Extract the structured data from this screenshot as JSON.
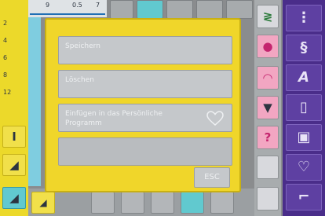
{
  "menu": {
    "items": [
      {
        "label": "Speichern",
        "enabled": true
      },
      {
        "label": "Löschen",
        "enabled": true
      },
      {
        "label": "Einfügen in das Persönliche Programm",
        "enabled": true,
        "icon": "heart-icon"
      },
      {
        "label": "",
        "enabled": false
      }
    ],
    "esc_label": "ESC"
  },
  "top_ruler": {
    "labels": [
      "9",
      "0.5",
      "7"
    ]
  },
  "left_ruler": {
    "labels": [
      "2",
      "4",
      "6",
      "8",
      "12"
    ]
  },
  "colors": {
    "dialog": "#f0d62a",
    "accent_purple": "#4a2d8a",
    "accent_pink": "#e23c86",
    "teal": "#61c9cf"
  }
}
